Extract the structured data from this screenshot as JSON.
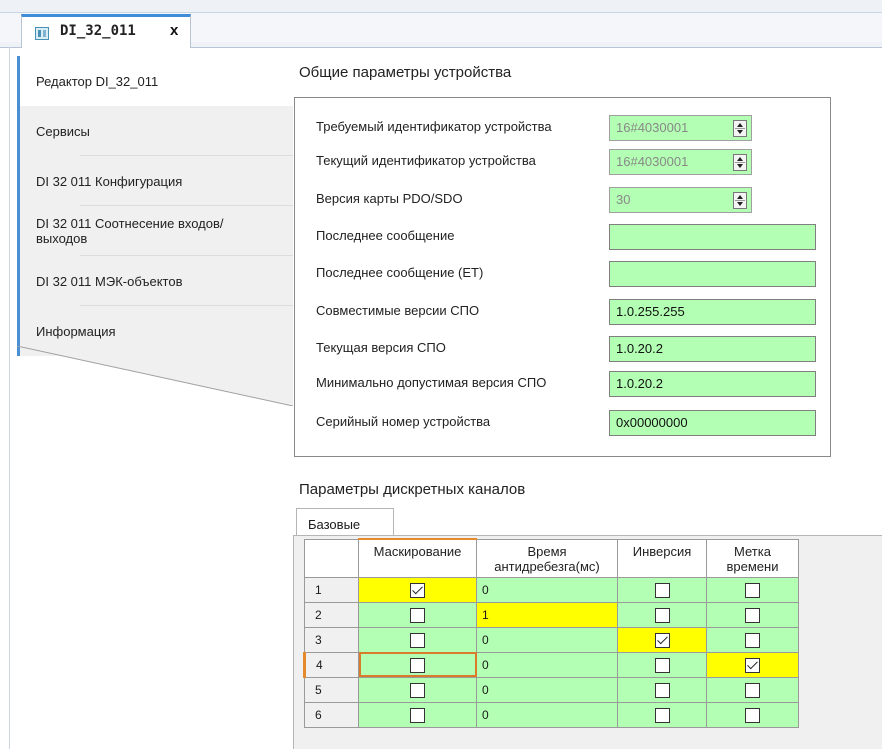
{
  "document_tab": {
    "title": "DI_32_011",
    "close_glyph": "x",
    "icon": "device-icon"
  },
  "sidebar": {
    "items": [
      {
        "label": "Редактор DI_32_011",
        "active": true
      },
      {
        "label": "Сервисы",
        "active": false
      },
      {
        "label": "DI 32 011 Конфигурация",
        "active": false
      },
      {
        "label": "DI 32 011 Соотнесение входов/выходов",
        "active": false
      },
      {
        "label": "DI 32 011 МЭК-объектов",
        "active": false
      },
      {
        "label": "Информация",
        "active": false
      }
    ]
  },
  "general": {
    "title": "Общие параметры устройства",
    "rows": [
      {
        "label": "Требуемый идентификатор устройства",
        "value": "16#4030001",
        "kind": "spin"
      },
      {
        "label": "Текущий идентификатор устройства",
        "value": "16#4030001",
        "kind": "spin"
      },
      {
        "label": "Версия карты PDO/SDO",
        "value": "30",
        "kind": "spin"
      },
      {
        "label": "Последнее сообщение",
        "value": "",
        "kind": "text"
      },
      {
        "label": "Последнее сообщение (ET)",
        "value": "",
        "kind": "text"
      },
      {
        "label": "Совместимые версии СПО",
        "value": "1.0.255.255",
        "kind": "text"
      },
      {
        "label": "Текущая версия СПО",
        "value": "1.0.20.2",
        "kind": "text"
      },
      {
        "label": "Минимально допустимая версия СПО",
        "value": "1.0.20.2",
        "kind": "text"
      },
      {
        "label": "Серийный номер устройства",
        "value": "0x00000000",
        "kind": "text"
      }
    ]
  },
  "channels": {
    "title": "Параметры дискретных каналов",
    "tab_label": "Базовые",
    "columns": [
      "Маскирование",
      "Время антидребезга(мс)",
      "Инверсия",
      "Метка времени"
    ],
    "rows": [
      {
        "n": "1",
        "mask": true,
        "debounce": "0",
        "invert": false,
        "timestamp": false,
        "hl": [
          "mask"
        ]
      },
      {
        "n": "2",
        "mask": false,
        "debounce": "1",
        "invert": false,
        "timestamp": false,
        "hl": [
          "debounce"
        ]
      },
      {
        "n": "3",
        "mask": false,
        "debounce": "0",
        "invert": true,
        "timestamp": false,
        "hl": [
          "invert"
        ]
      },
      {
        "n": "4",
        "mask": false,
        "debounce": "0",
        "invert": false,
        "timestamp": true,
        "hl": [
          "timestamp"
        ],
        "current": true
      },
      {
        "n": "5",
        "mask": false,
        "debounce": "0",
        "invert": false,
        "timestamp": false,
        "hl": []
      },
      {
        "n": "6",
        "mask": false,
        "debounce": "0",
        "invert": false,
        "timestamp": false,
        "hl": []
      }
    ]
  },
  "colors": {
    "field_bg": "#b3ffb3",
    "highlight": "#ffff00",
    "accent_blue": "#4a8fd4",
    "accent_orange": "#e58a2c"
  }
}
